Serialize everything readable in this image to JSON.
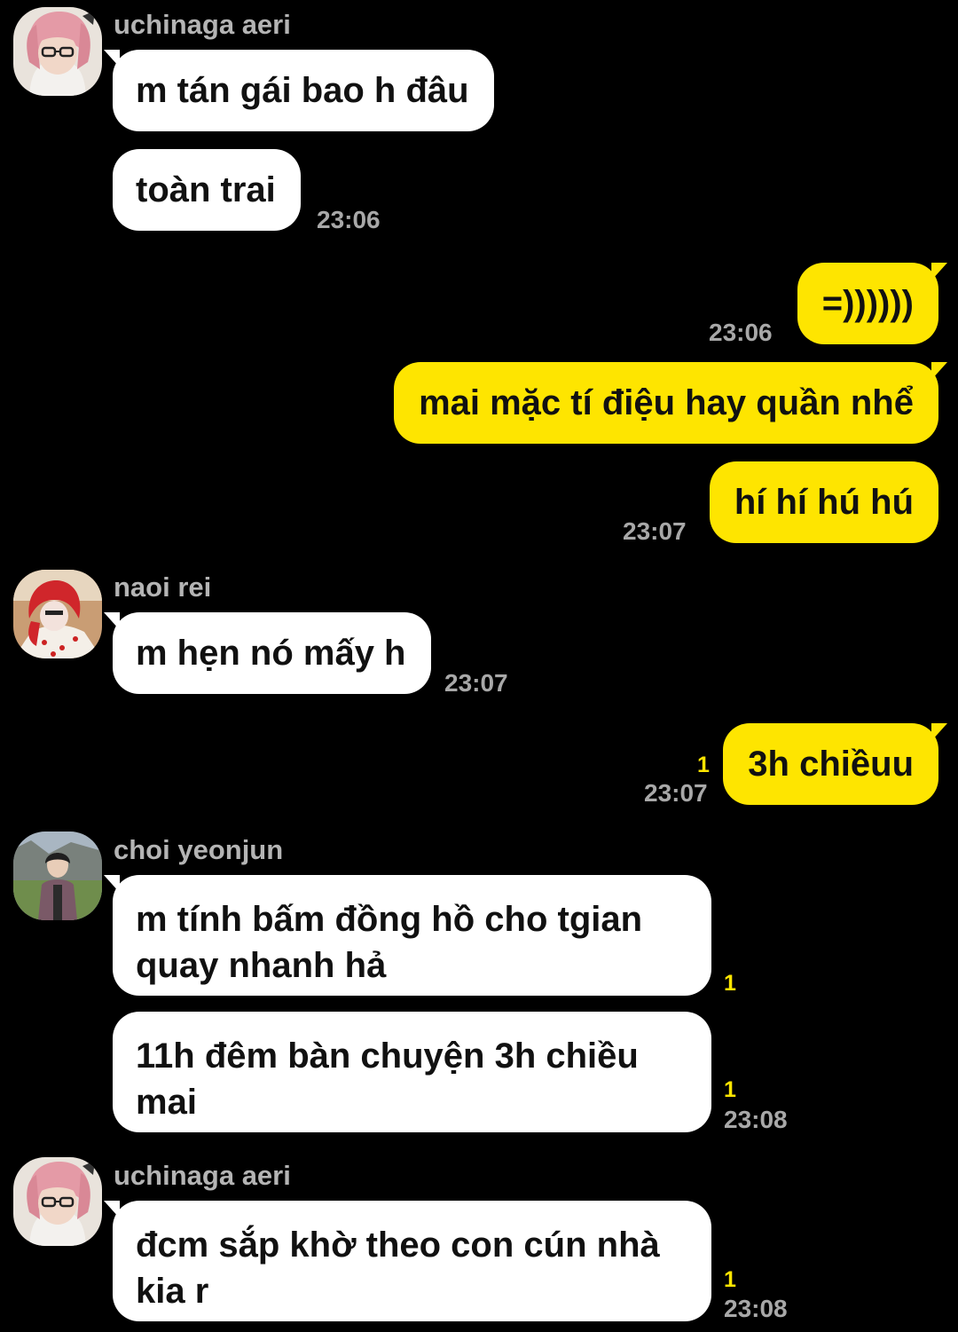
{
  "colors": {
    "background": "#000000",
    "incoming_bubble": "#ffffff",
    "outgoing_bubble": "#fee500",
    "unread": "#ffe500",
    "timestamp": "#a8a8a8"
  },
  "groups": [
    {
      "sender": "uchinaga aeri",
      "avatar_icon": "pink-haired-girl-avatar",
      "messages": [
        "m tán gái bao h đâu",
        "toàn trai"
      ],
      "time": "23:06"
    },
    {
      "sender": "me",
      "messages": [
        "=))))))"
      ],
      "time": "23:06"
    },
    {
      "sender": "me",
      "messages": [
        "mai mặc tí điệu hay quần nhể",
        "hí hí hú hú"
      ],
      "time": "23:07"
    },
    {
      "sender": "naoi rei",
      "avatar_icon": "red-bonnet-girl-avatar",
      "messages": [
        "m hẹn nó mấy h"
      ],
      "time": "23:07"
    },
    {
      "sender": "me",
      "messages": [
        "3h chiềuu"
      ],
      "unread": "1",
      "time": "23:07"
    },
    {
      "sender": "choi yeonjun",
      "avatar_icon": "boy-in-park-avatar",
      "messages": [
        "m tính bấm đồng hồ cho tgian quay nhanh hả",
        "11h đêm bàn chuyện 3h chiều mai"
      ],
      "unread": [
        "1",
        "1"
      ],
      "time": "23:08"
    },
    {
      "sender": "uchinaga aeri",
      "avatar_icon": "pink-haired-girl-avatar",
      "messages": [
        "đcm sắp khờ theo con cún nhà kia r"
      ],
      "unread": "1",
      "time": "23:08"
    }
  ]
}
